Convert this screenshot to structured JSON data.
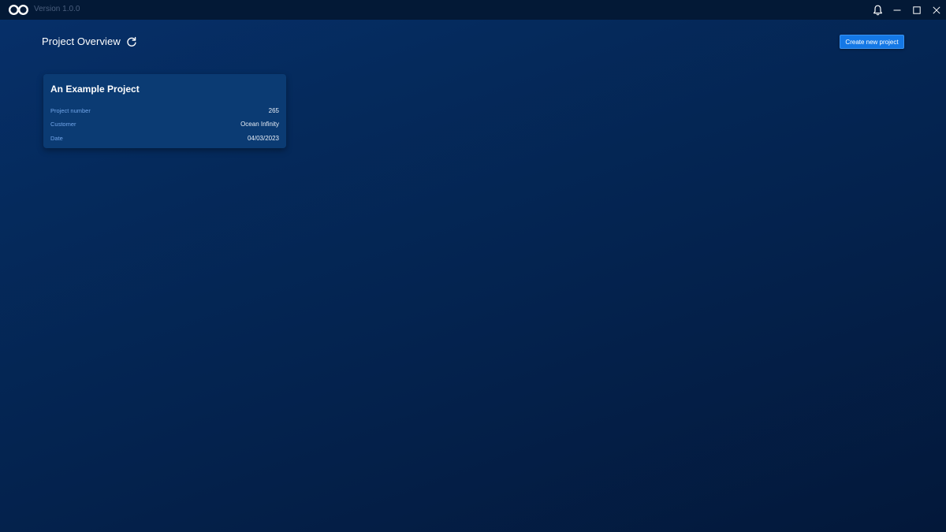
{
  "titlebar": {
    "logo_icon": "infinity-logo-icon",
    "version": "Version 1.0.0",
    "controls": [
      "bell-icon",
      "minimize-icon",
      "maximize-icon",
      "close-icon"
    ]
  },
  "header": {
    "title": "Project Overview",
    "refresh_icon": "refresh-icon",
    "create_button_label": "Create new project"
  },
  "projects": [
    {
      "title": "An Example Project",
      "fields": [
        {
          "label": "Project number",
          "value": "265"
        },
        {
          "label": "Customer",
          "value": "Ocean Infinity"
        },
        {
          "label": "Date",
          "value": "04/03/2023"
        }
      ]
    }
  ],
  "colors": {
    "background_top": "#06306a",
    "background_bottom": "#03183a",
    "titlebar": "#031936",
    "card": "#0b3b73",
    "accent_button": "#1478e6",
    "label_text": "#72a6ea"
  }
}
